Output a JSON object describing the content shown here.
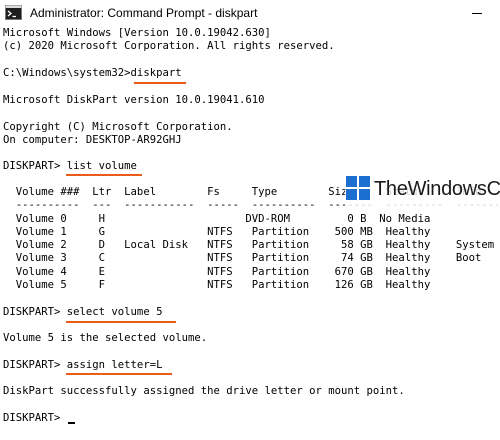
{
  "window": {
    "title": "Administrator: Command Prompt - diskpart"
  },
  "icons": {
    "app": "cmd-icon",
    "minimize": "minimize-icon",
    "watermark": "thewindowsclub-logo-icon"
  },
  "colors": {
    "highlight": "#ea5d18",
    "watermark_blue": "#1a6fd0"
  },
  "console": {
    "header": [
      "Microsoft Windows [Version 10.0.19042.630]",
      "(c) 2020 Microsoft Corporation. All rights reserved."
    ],
    "cmd_diskpart": "C:\\Windows\\system32>diskpart",
    "diskpart_version": "Microsoft DiskPart version 10.0.19041.610",
    "copyright": "Copyright (C) Microsoft Corporation.",
    "computer": "On computer: DESKTOP-AR92GHJ",
    "cmd_list": "DISKPART> list volume",
    "table_header": "  Volume ###  Ltr  Label        Fs     Type        Size     Status     Info",
    "table_separator": "  ----------  ---  -----------  -----  ----------  -------  ---------  --------",
    "volumes": [
      "  Volume 0     H                      DVD-ROM         0 B  No Media",
      "  Volume 1     G                NTFS   Partition    500 MB  Healthy",
      "  Volume 2     D   Local Disk   NTFS   Partition     58 GB  Healthy    System",
      "  Volume 3     C                NTFS   Partition     74 GB  Healthy    Boot",
      "  Volume 4     E                NTFS   Partition    670 GB  Healthy",
      "  Volume 5     F                NTFS   Partition    126 GB  Healthy"
    ],
    "cmd_select": "DISKPART> select volume 5",
    "select_result": "Volume 5 is the selected volume.",
    "cmd_assign": "DISKPART> assign letter=L",
    "assign_result": "DiskPart successfully assigned the drive letter or mount point.",
    "prompt": "DISKPART> "
  },
  "watermark": {
    "text": "TheWindowsClub"
  }
}
